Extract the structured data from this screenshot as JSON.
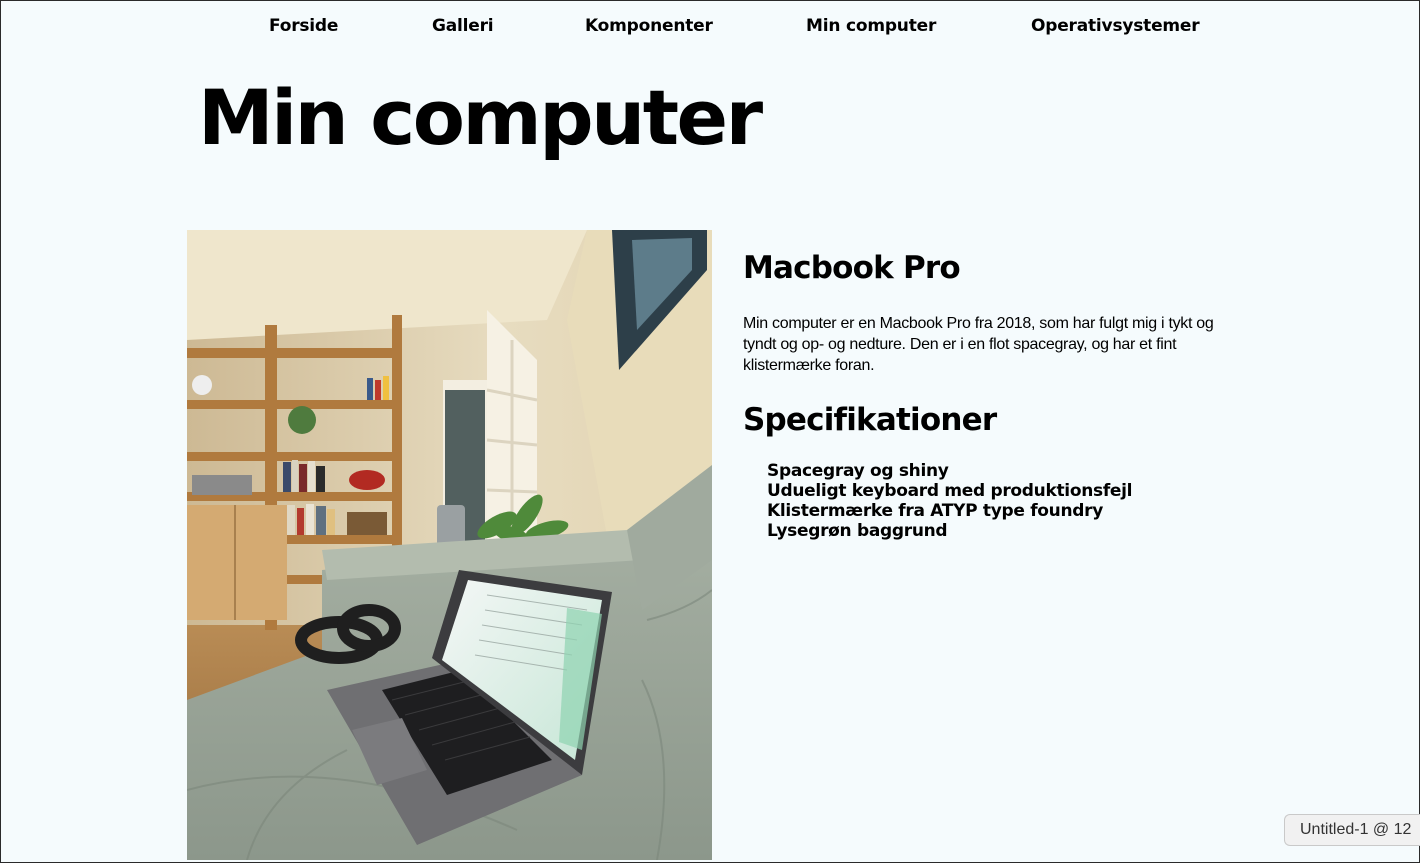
{
  "nav": {
    "items": [
      {
        "label": "Forside"
      },
      {
        "label": "Galleri"
      },
      {
        "label": "Komponenter"
      },
      {
        "label": "Min computer"
      },
      {
        "label": "Operativsystemer"
      }
    ]
  },
  "page": {
    "title": "Min computer"
  },
  "photo": {
    "subject": "laptop-on-sofa-photo"
  },
  "content": {
    "heading": "Macbook Pro",
    "description": "Min computer er en Macbook Pro fra 2018, som har fulgt mig i tykt og tyndt og op- og nedture. Den er i en flot spacegray, og har et fint klistermærke foran.",
    "specs_heading": "Specifikationer",
    "specs": [
      "Spacegray og shiny",
      "Udueligt keyboard med produktionsfejl",
      "Klistermærke fra ATYP type foundry",
      "Lysegrøn baggrund"
    ]
  },
  "overlay": {
    "tab_label": "Untitled-1 @ 12"
  },
  "colors": {
    "background": "#f5fbfd",
    "text": "#000000"
  }
}
